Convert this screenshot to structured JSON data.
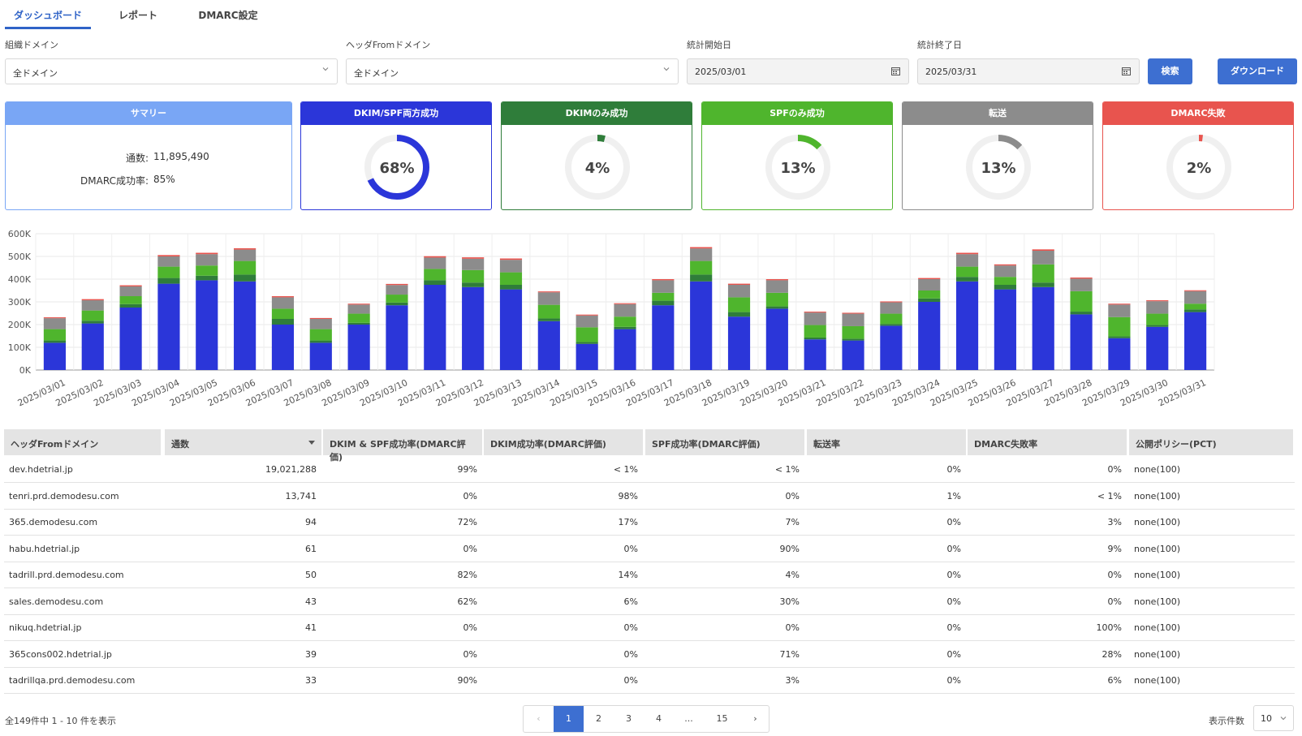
{
  "tabs": [
    {
      "label": "ダッシュボード",
      "active": true
    },
    {
      "label": "レポート",
      "active": false
    },
    {
      "label": "DMARC設定",
      "active": false
    }
  ],
  "filters": {
    "org_domain": {
      "label": "組織ドメイン",
      "value": "全ドメイン"
    },
    "header_from_domain": {
      "label": "ヘッダFromドメイン",
      "value": "全ドメイン"
    },
    "start_date": {
      "label": "統計開始日",
      "value": "2025/03/01"
    },
    "end_date": {
      "label": "統計終了日",
      "value": "2025/03/31"
    },
    "search_label": "検索",
    "download_label": "ダウンロード"
  },
  "summary": {
    "title": "サマリー",
    "count_label": "通数:",
    "count_value": "11,895,490",
    "rate_label": "DMARC成功率:",
    "rate_value": "85%"
  },
  "kpis": [
    {
      "title": "DKIM/SPF両方成功",
      "value": "68%",
      "percent": 68,
      "color": "#2b36d9"
    },
    {
      "title": "DKIMのみ成功",
      "value": "4%",
      "percent": 4,
      "color": "#2f7d3a"
    },
    {
      "title": "SPFのみ成功",
      "value": "13%",
      "percent": 13,
      "color": "#4fb52d"
    },
    {
      "title": "転送",
      "value": "13%",
      "percent": 13,
      "color": "#8c8c8c"
    },
    {
      "title": "DMARC失敗",
      "value": "2%",
      "percent": 2,
      "color": "#e8544e"
    }
  ],
  "colors": {
    "accent": "#3d6fd1",
    "summary_header": "#79a6f5",
    "dkim_spf": "#2b36d9",
    "dkim_only": "#2f7d3a",
    "spf_only": "#4fb52d",
    "forward": "#8c8c8c",
    "fail": "#e8544e"
  },
  "chart_data": {
    "type": "bar",
    "stacked": true,
    "categories": [
      "2025/03/01",
      "2025/03/02",
      "2025/03/03",
      "2025/03/04",
      "2025/03/05",
      "2025/03/06",
      "2025/03/07",
      "2025/03/08",
      "2025/03/09",
      "2025/03/10",
      "2025/03/11",
      "2025/03/12",
      "2025/03/13",
      "2025/03/14",
      "2025/03/15",
      "2025/03/16",
      "2025/03/17",
      "2025/03/18",
      "2025/03/19",
      "2025/03/20",
      "2025/03/21",
      "2025/03/22",
      "2025/03/23",
      "2025/03/24",
      "2025/03/25",
      "2025/03/26",
      "2025/03/27",
      "2025/03/28",
      "2025/03/29",
      "2025/03/30",
      "2025/03/31"
    ],
    "ylim": [
      0,
      600000
    ],
    "yticks": [
      "0K",
      "100K",
      "200K",
      "300K",
      "400K",
      "500K",
      "600K"
    ],
    "grid": true,
    "series": [
      {
        "color": "#2b36d9",
        "values": [
          120000,
          205000,
          275000,
          380000,
          395000,
          390000,
          200000,
          120000,
          200000,
          285000,
          375000,
          365000,
          355000,
          215000,
          115000,
          180000,
          285000,
          390000,
          235000,
          270000,
          135000,
          130000,
          195000,
          300000,
          390000,
          355000,
          365000,
          245000,
          140000,
          190000,
          255000
        ]
      },
      {
        "color": "#2f7d3a",
        "values": [
          10000,
          12000,
          15000,
          25000,
          20000,
          30000,
          25000,
          10000,
          8000,
          12000,
          20000,
          20000,
          20000,
          12000,
          8000,
          10000,
          20000,
          30000,
          20000,
          10000,
          8000,
          8000,
          8000,
          15000,
          20000,
          20000,
          20000,
          12000,
          8000,
          8000,
          12000
        ]
      },
      {
        "color": "#4fb52d",
        "values": [
          50000,
          45000,
          35000,
          50000,
          45000,
          60000,
          45000,
          50000,
          40000,
          35000,
          50000,
          55000,
          55000,
          60000,
          65000,
          45000,
          35000,
          60000,
          65000,
          60000,
          55000,
          55000,
          45000,
          35000,
          45000,
          35000,
          80000,
          90000,
          85000,
          50000,
          25000
        ]
      },
      {
        "color": "#8c8c8c",
        "values": [
          48000,
          45000,
          43000,
          45000,
          50000,
          50000,
          50000,
          45000,
          40000,
          42000,
          50000,
          50000,
          55000,
          55000,
          52000,
          55000,
          55000,
          55000,
          55000,
          55000,
          55000,
          55000,
          50000,
          50000,
          55000,
          50000,
          60000,
          55000,
          55000,
          55000,
          55000
        ]
      },
      {
        "color": "#e8544e",
        "values": [
          4000,
          5000,
          5000,
          6000,
          6000,
          6000,
          5000,
          4000,
          4000,
          5000,
          6000,
          6000,
          6000,
          4000,
          4000,
          4000,
          5000,
          6000,
          5000,
          5000,
          4000,
          4000,
          4000,
          5000,
          6000,
          5000,
          6000,
          5000,
          4000,
          4000,
          4000
        ]
      }
    ]
  },
  "table": {
    "columns": [
      "ヘッダFromドメイン",
      "通数",
      "DKIM & SPF成功率(DMARC評価)",
      "DKIM成功率(DMARC評価)",
      "SPF成功率(DMARC評価)",
      "転送率",
      "DMARC失敗率",
      "公開ポリシー(PCT)"
    ],
    "rows": [
      [
        "dev.hdetrial.jp",
        "19,021,288",
        "99%",
        "< 1%",
        "< 1%",
        "0%",
        "0%",
        "none(100)"
      ],
      [
        "tenri.prd.demodesu.com",
        "13,741",
        "0%",
        "98%",
        "0%",
        "1%",
        "< 1%",
        "none(100)"
      ],
      [
        "365.demodesu.com",
        "94",
        "72%",
        "17%",
        "7%",
        "0%",
        "3%",
        "none(100)"
      ],
      [
        "habu.hdetrial.jp",
        "61",
        "0%",
        "0%",
        "90%",
        "0%",
        "9%",
        "none(100)"
      ],
      [
        "tadrill.prd.demodesu.com",
        "50",
        "82%",
        "14%",
        "4%",
        "0%",
        "0%",
        "none(100)"
      ],
      [
        "sales.demodesu.com",
        "43",
        "62%",
        "6%",
        "30%",
        "0%",
        "0%",
        "none(100)"
      ],
      [
        "nikuq.hdetrial.jp",
        "41",
        "0%",
        "0%",
        "0%",
        "0%",
        "100%",
        "none(100)"
      ],
      [
        "365cons002.hdetrial.jp",
        "39",
        "0%",
        "0%",
        "71%",
        "0%",
        "28%",
        "none(100)"
      ],
      [
        "tadrillqa.prd.demodesu.com",
        "33",
        "90%",
        "0%",
        "3%",
        "0%",
        "6%",
        "none(100)"
      ]
    ]
  },
  "footer": {
    "count_text": "全149件中 1 - 10 件を表示",
    "pages": [
      "‹",
      "1",
      "2",
      "3",
      "4",
      "...",
      "15",
      "›"
    ],
    "current_page": "1",
    "per_page_label": "表示件数",
    "per_page_value": "10"
  }
}
